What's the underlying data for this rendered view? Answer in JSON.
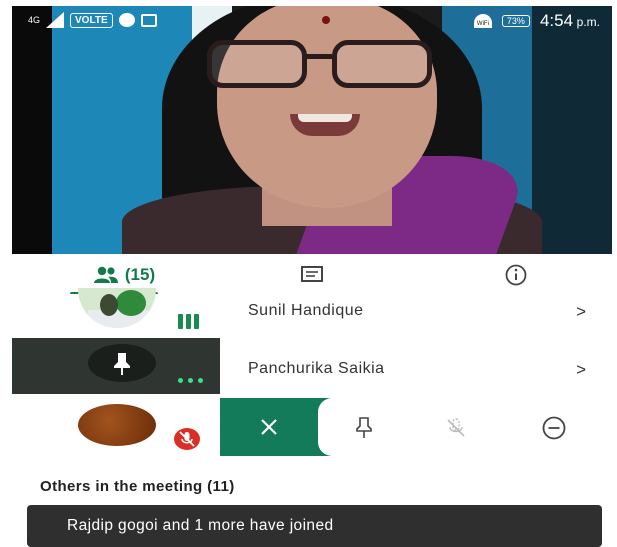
{
  "status_bar": {
    "network": "4G",
    "volte": "VOLTE",
    "wifi": "WiFi",
    "battery": "73%",
    "time": "4:54",
    "ampm": "p.m."
  },
  "tabs": {
    "people_count": "(15)",
    "icons": [
      "people-icon",
      "chat-icon",
      "info-icon"
    ]
  },
  "participants": [
    {
      "name": "Sunil Handique",
      "chevron": ">",
      "state": "speaking"
    },
    {
      "name": "Panchurika Saikia",
      "chevron": ">",
      "state": "pinned"
    },
    {
      "name": "",
      "state": "muted",
      "actions": [
        "close-icon",
        "pin-icon",
        "mute-icon",
        "remove-icon"
      ]
    }
  ],
  "others": {
    "heading": "Others in the meeting (11)"
  },
  "toast": {
    "message": "Rajdip gogoi and 1 more have joined"
  },
  "colors": {
    "accent": "#137a4a",
    "action_strip": "#137a5a",
    "mute_badge": "#d93025",
    "toast_bg": "#2f2f2f"
  }
}
